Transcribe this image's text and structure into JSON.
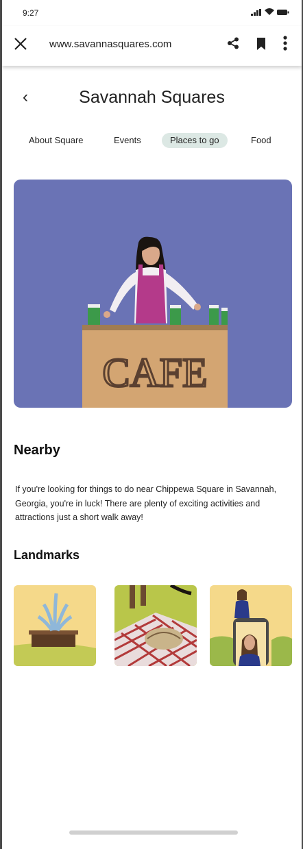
{
  "status": {
    "time": "9:27"
  },
  "browser": {
    "url": "www.savannasquares.com"
  },
  "header": {
    "back": "‹",
    "title": "Savannah Squares"
  },
  "tabs": [
    "About Square",
    "Events",
    "Places to go",
    "Food"
  ],
  "active_tab": "Places to go",
  "hero": {
    "sign_text": "CAFE"
  },
  "nearby": {
    "heading": "Nearby",
    "text": "If you're looking for things to do near Chippewa Square in Savannah, Georgia, you're in luck! There are plenty of exciting activities and attractions just a short walk away!"
  },
  "landmarks": {
    "heading": "Landmarks"
  },
  "colors": {
    "hero_bg": "#6a73b5",
    "active_tab_bg": "#dce8e4",
    "card_bg": "#f5d98a",
    "grass": "#c3ca55"
  }
}
